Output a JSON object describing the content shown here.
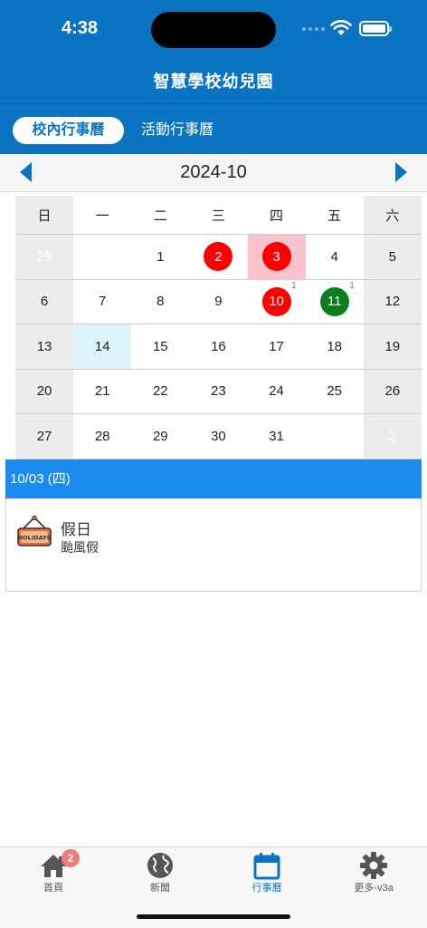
{
  "status": {
    "time": "4:38"
  },
  "app": {
    "title": "智慧學校幼兒園"
  },
  "tabs": [
    {
      "label": "校內行事曆",
      "active": true
    },
    {
      "label": "活動行事曆",
      "active": false
    }
  ],
  "calendar": {
    "month": "2024-10",
    "weekdays": [
      "日",
      "一",
      "二",
      "三",
      "四",
      "五",
      "六"
    ],
    "weeks": [
      [
        "29",
        "",
        "1",
        "2",
        "3",
        "4",
        "5"
      ],
      [
        "6",
        "7",
        "8",
        "9",
        "10",
        "11",
        "12"
      ],
      [
        "13",
        "14",
        "15",
        "16",
        "17",
        "18",
        "19"
      ],
      [
        "20",
        "21",
        "22",
        "23",
        "24",
        "25",
        "26"
      ],
      [
        "27",
        "28",
        "29",
        "30",
        "31",
        "",
        "2"
      ]
    ],
    "badges": {
      "10": "1",
      "11": "1"
    },
    "colors": {
      "red": "#ff0000",
      "green": "#0a7f1a",
      "selected": "#f9c2cc",
      "today": "#dcf3fb"
    }
  },
  "selected_day": {
    "header": "10/03 (四)",
    "event": {
      "title": "假日",
      "description": "颱風假",
      "icon": "holidays-sign-icon",
      "icon_text": "HOLIDAYS"
    }
  },
  "bottom_nav": [
    {
      "label": "首頁",
      "icon": "home-icon",
      "badge": "2"
    },
    {
      "label": "新聞",
      "icon": "globe-icon"
    },
    {
      "label": "行事曆",
      "icon": "calendar-icon",
      "active": true
    },
    {
      "label": "更多-v3a",
      "icon": "gear-icon"
    }
  ],
  "theme": {
    "primary": "#0a73c2",
    "accent": "#1a8cf0"
  }
}
